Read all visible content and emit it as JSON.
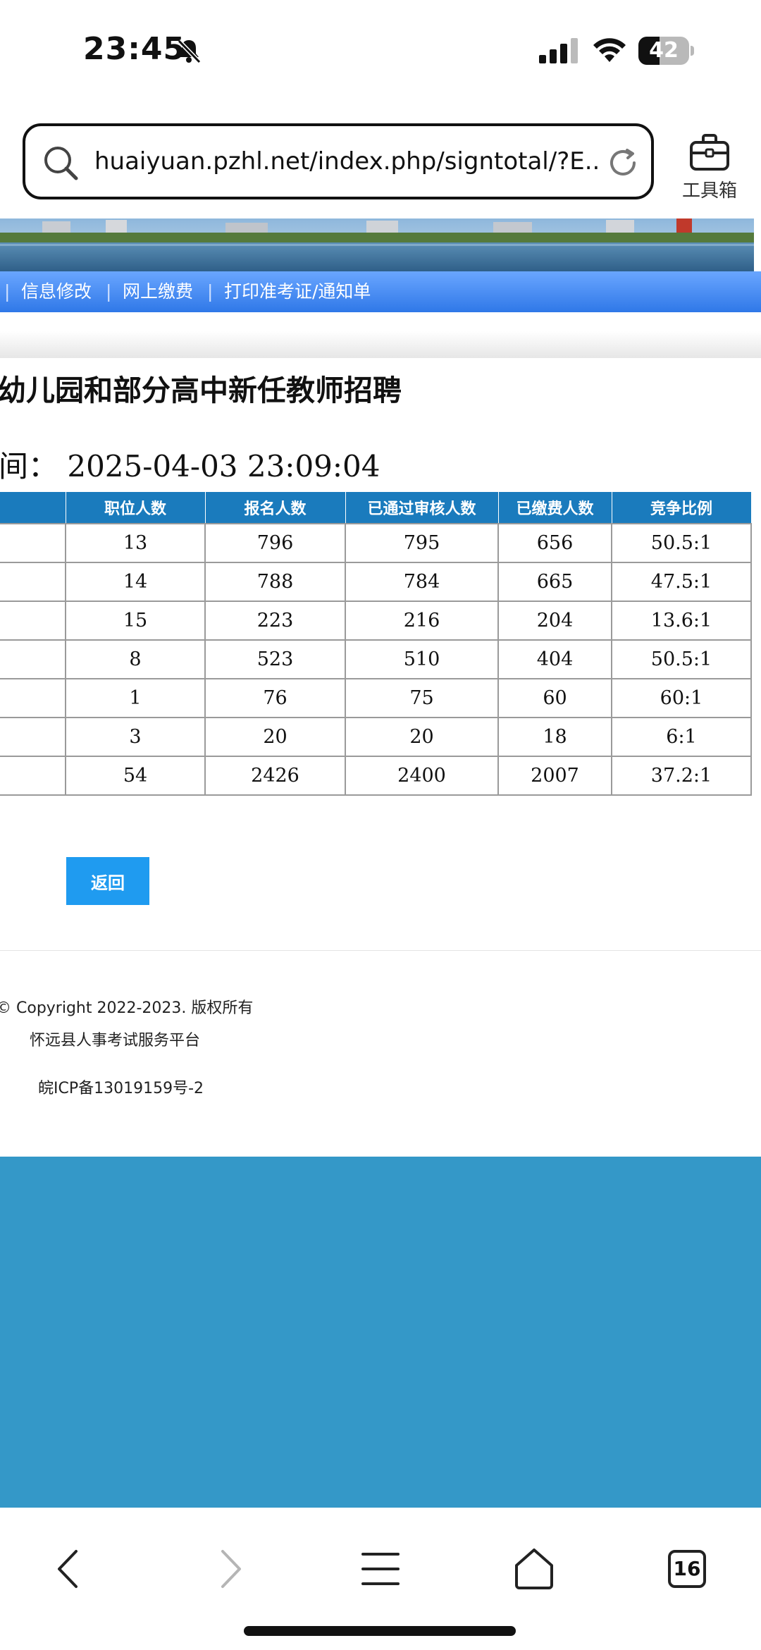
{
  "status_bar": {
    "time": "23:45",
    "battery": "42",
    "battery_level": 0.42
  },
  "address_bar": {
    "url": "huaiyuan.pzhl.net/index.php/signtotal/?E..."
  },
  "toolbox": {
    "label": "工具箱"
  },
  "nav": {
    "items": [
      "信息修改",
      "网上缴费",
      "打印准考证/通知单"
    ]
  },
  "page": {
    "title": "幼儿园和部分高中新任教师招聘",
    "stat_time": "间：  2025-04-03 23:09:04"
  },
  "table": {
    "headers": [
      "职位人数",
      "报名人数",
      "已通过审核人数",
      "已缴费人数",
      "竞争比例"
    ],
    "rows": [
      [
        "13",
        "796",
        "795",
        "656",
        "50.5:1"
      ],
      [
        "14",
        "788",
        "784",
        "665",
        "47.5:1"
      ],
      [
        "15",
        "223",
        "216",
        "204",
        "13.6:1"
      ],
      [
        "8",
        "523",
        "510",
        "404",
        "50.5:1"
      ],
      [
        "1",
        "76",
        "75",
        "60",
        "60:1"
      ],
      [
        "3",
        "20",
        "20",
        "18",
        "6:1"
      ],
      [
        "54",
        "2426",
        "2400",
        "2007",
        "37.2:1"
      ]
    ]
  },
  "back_button": {
    "label": "返回"
  },
  "footer": {
    "copyright": "© Copyright 2022-2023. 版权所有",
    "platform": "怀远县人事考试服务平台",
    "icp": "皖ICP备13019159号-2"
  },
  "bottom_bar": {
    "tabs_count": "16"
  }
}
